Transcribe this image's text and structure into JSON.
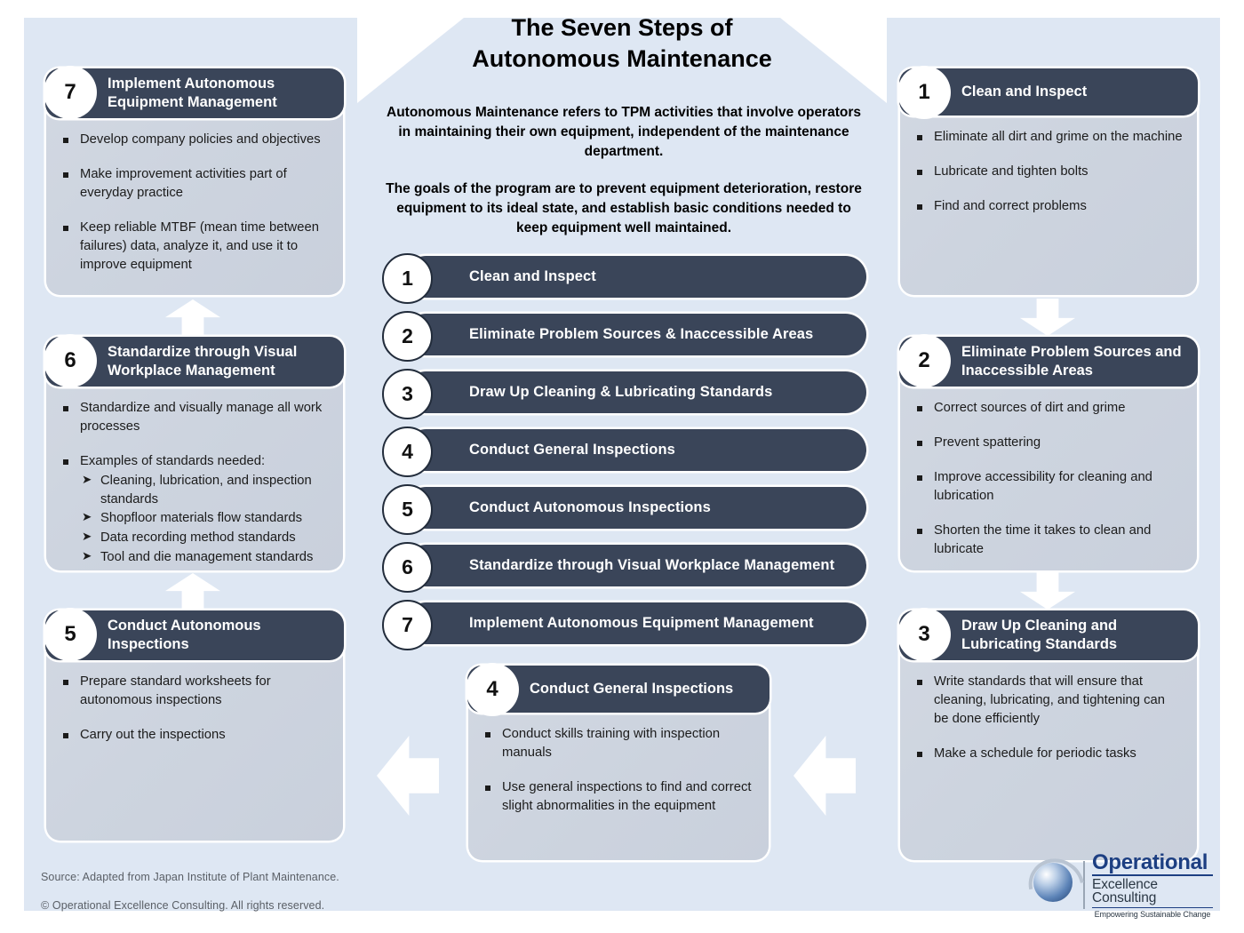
{
  "header": {
    "title_line1": "The Seven Steps of",
    "title_line2": "Autonomous Maintenance",
    "intro_paragraph_1": "Autonomous Maintenance refers to TPM activities that involve operators in maintaining their own equipment, independent of the maintenance department.",
    "intro_paragraph_2": "The goals of the program are to prevent equipment deterioration, restore equipment to its ideal state, and establish basic conditions needed to keep equipment well maintained."
  },
  "step_list": [
    {
      "number": "1",
      "label": "Clean and Inspect"
    },
    {
      "number": "2",
      "label": "Eliminate Problem Sources & Inaccessible Areas"
    },
    {
      "number": "3",
      "label": "Draw Up Cleaning & Lubricating Standards"
    },
    {
      "number": "4",
      "label": "Conduct General Inspections"
    },
    {
      "number": "5",
      "label": "Conduct Autonomous Inspections"
    },
    {
      "number": "6",
      "label": "Standardize through Visual Workplace Management"
    },
    {
      "number": "7",
      "label": "Implement Autonomous Equipment Management"
    }
  ],
  "cards": {
    "step1": {
      "number": "1",
      "title": "Clean and Inspect",
      "bullets": [
        "Eliminate all dirt and grime on the machine",
        "Lubricate and tighten bolts",
        "Find and correct problems"
      ]
    },
    "step2": {
      "number": "2",
      "title": "Eliminate Problem Sources and Inaccessible Areas",
      "bullets": [
        "Correct sources of dirt and grime",
        "Prevent spattering",
        "Improve accessibility for cleaning and lubrication",
        "Shorten the time it takes to clean and lubricate"
      ]
    },
    "step3": {
      "number": "3",
      "title": "Draw Up Cleaning and Lubricating Standards",
      "bullets": [
        "Write standards that will ensure that cleaning, lubricating, and tightening can be done efficiently",
        "Make a schedule for periodic tasks"
      ]
    },
    "step4": {
      "number": "4",
      "title": "Conduct General Inspections",
      "bullets": [
        "Conduct skills training with inspection manuals",
        "Use general inspections to find and correct slight abnormalities in the equipment"
      ]
    },
    "step5": {
      "number": "5",
      "title": "Conduct Autonomous Inspections",
      "bullets": [
        "Prepare standard worksheets for autonomous inspections",
        "Carry out the inspections"
      ]
    },
    "step6": {
      "number": "6",
      "title": "Standardize through Visual Workplace Management",
      "bullets": [
        "Standardize and visually manage all work processes",
        "Examples of standards needed:"
      ],
      "sub_bullets": [
        "Cleaning, lubrication, and inspection standards",
        "Shopfloor materials flow standards",
        "Data recording method standards",
        "Tool and die management standards"
      ],
      "sub_marker": "➤"
    },
    "step7": {
      "number": "7",
      "title": "Implement Autonomous Equipment Management",
      "bullets": [
        "Develop company policies and objectives",
        "Make improvement activities part of everyday practice",
        "Keep reliable MTBF (mean time between failures) data, analyze it, and use it to improve equipment"
      ]
    }
  },
  "footer": {
    "source": "Source: Adapted from Japan Institute of Plant Maintenance.",
    "copyright": "© Operational Excellence Consulting. All rights reserved."
  },
  "logo": {
    "line1": "Operational",
    "line2": "Excellence Consulting",
    "line3": "Empowering Sustainable Change"
  },
  "colors": {
    "panel_background": "#dee7f3",
    "header_dark": "#3a4559",
    "card_body": "#cdd4df",
    "arrow_white": "#ffffff",
    "logo_blue": "#1d3f82"
  }
}
